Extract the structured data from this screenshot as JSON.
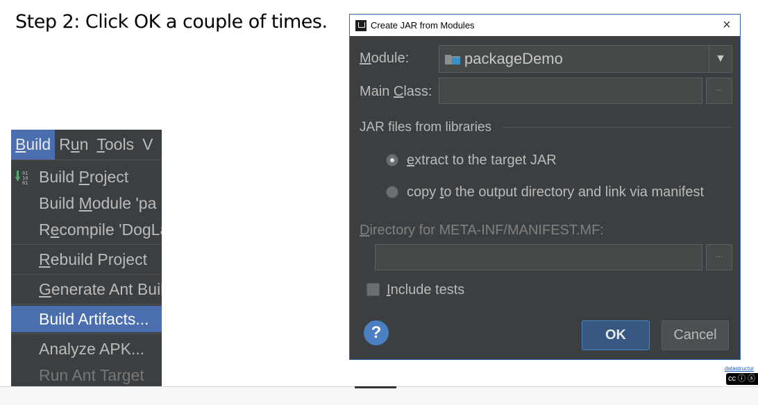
{
  "step_text": "Step 2: Click OK a couple of times.",
  "menu": {
    "bar": [
      {
        "pre": "",
        "u": "B",
        "post": "uild"
      },
      {
        "pre": "R",
        "u": "u",
        "post": "n"
      },
      {
        "pre": "",
        "u": "T",
        "post": "ools"
      },
      {
        "pre": "V",
        "u": "",
        "post": ""
      }
    ],
    "items": [
      {
        "pre": "Build ",
        "u": "P",
        "post": "roject"
      },
      {
        "pre": "Build ",
        "u": "M",
        "post": "odule 'pa"
      },
      {
        "pre": "R",
        "u": "e",
        "post": "compile 'DogLa"
      },
      {
        "pre": "",
        "u": "R",
        "post": "ebuild Project"
      },
      {
        "pre": "",
        "u": "G",
        "post": "enerate Ant Buil"
      },
      {
        "pre": "Build Artifacts...",
        "u": "",
        "post": ""
      },
      {
        "pre": "Analyze APK...",
        "u": "",
        "post": ""
      },
      {
        "pre": "Run Ant Target",
        "u": "",
        "post": ""
      }
    ]
  },
  "dialog": {
    "title": "Create JAR from Modules",
    "close": "×",
    "module_label": {
      "pre": "",
      "u": "M",
      "post": "odule:"
    },
    "module_value": "packageDemo",
    "dropdown_arrow": "▼",
    "main_class_label": {
      "pre": "Main ",
      "u": "C",
      "post": "lass:"
    },
    "main_class_value": "",
    "browse": "···",
    "jar_group_label": "JAR files from libraries",
    "radio_extract": {
      "pre": "",
      "u": "e",
      "post": "xtract to the target JAR"
    },
    "radio_copy": {
      "pre": "copy ",
      "u": "t",
      "post": "o the output directory and link via manifest"
    },
    "manifest_label": {
      "pre": "",
      "u": "D",
      "post": "irectory for META-INF/MANIFEST.MF:"
    },
    "manifest_value": "",
    "include_tests": {
      "pre": "",
      "u": "I",
      "post": "nclude tests"
    },
    "help": "?",
    "ok": "OK",
    "cancel": "Cancel"
  },
  "credit": {
    "text": "datastructur",
    "cc": "cc ⓘ ⓢ"
  }
}
